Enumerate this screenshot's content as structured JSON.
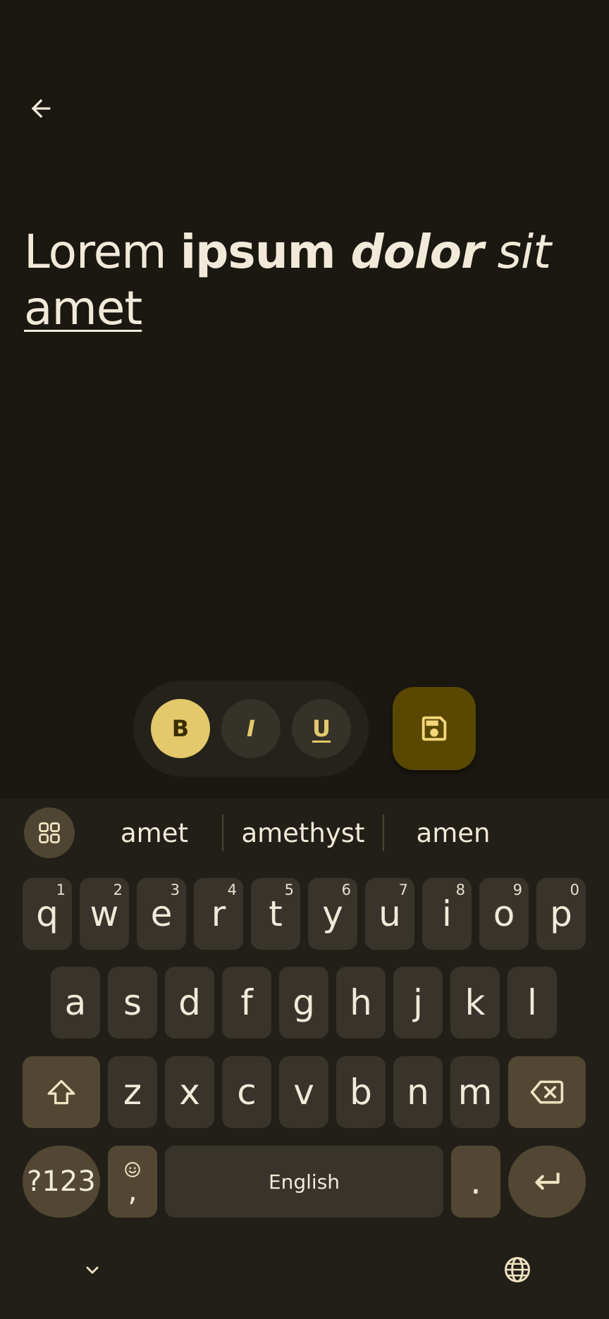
{
  "editor": {
    "w1": "Lorem ",
    "w2": "ipsum ",
    "w3": "dolor",
    "w4": " sit",
    "w5": "amet"
  },
  "format": {
    "bold": "B",
    "italic": "I",
    "underline": "U"
  },
  "suggestions": [
    "amet",
    "amethyst",
    "amen"
  ],
  "keyboard": {
    "row1": [
      {
        "k": "q",
        "h": "1"
      },
      {
        "k": "w",
        "h": "2"
      },
      {
        "k": "e",
        "h": "3"
      },
      {
        "k": "r",
        "h": "4"
      },
      {
        "k": "t",
        "h": "5"
      },
      {
        "k": "y",
        "h": "6"
      },
      {
        "k": "u",
        "h": "7"
      },
      {
        "k": "i",
        "h": "8"
      },
      {
        "k": "o",
        "h": "9"
      },
      {
        "k": "p",
        "h": "0"
      }
    ],
    "row2": [
      "a",
      "s",
      "d",
      "f",
      "g",
      "h",
      "j",
      "k",
      "l"
    ],
    "row3": [
      "z",
      "x",
      "c",
      "v",
      "b",
      "n",
      "m"
    ],
    "symbols": "?123",
    "comma": ",",
    "space": "English",
    "period": "."
  },
  "colors": {
    "background": "#1b1812",
    "accent": "#e3c86c",
    "fab": "#5a4800",
    "key": "#38342c",
    "func_key": "#514733"
  }
}
